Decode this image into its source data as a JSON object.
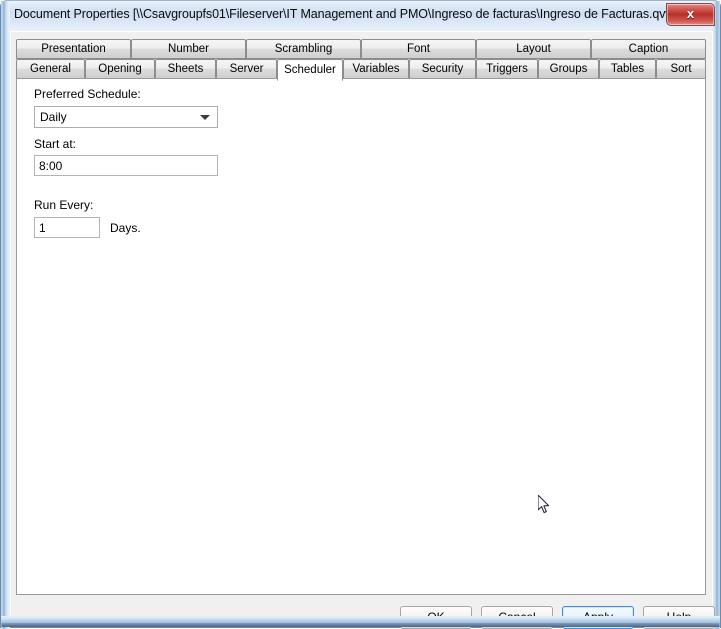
{
  "window": {
    "title": "Document Properties [\\\\Csavgroupfs01\\Fileserver\\IT Management and PMO\\Ingreso de facturas\\Ingreso de Facturas.qvw]",
    "close_glyph": "x",
    "close_label": "Close"
  },
  "tabs": {
    "top_row": [
      {
        "label": "Presentation",
        "active": false
      },
      {
        "label": "Number",
        "active": false
      },
      {
        "label": "Scrambling",
        "active": false
      },
      {
        "label": "Font",
        "active": false
      },
      {
        "label": "Layout",
        "active": false
      },
      {
        "label": "Caption",
        "active": false
      }
    ],
    "bottom_row": [
      {
        "label": "General",
        "active": false
      },
      {
        "label": "Opening",
        "active": false
      },
      {
        "label": "Sheets",
        "active": false
      },
      {
        "label": "Server",
        "active": false
      },
      {
        "label": "Scheduler",
        "active": true
      },
      {
        "label": "Variables",
        "active": false
      },
      {
        "label": "Security",
        "active": false
      },
      {
        "label": "Triggers",
        "active": false
      },
      {
        "label": "Groups",
        "active": false
      },
      {
        "label": "Tables",
        "active": false
      },
      {
        "label": "Sort",
        "active": false
      }
    ]
  },
  "scheduler": {
    "preferred_schedule_label": "Preferred Schedule:",
    "preferred_schedule_value": "Daily",
    "preferred_schedule_options": [
      "Daily"
    ],
    "start_at_label": "Start at:",
    "start_at_value": "8:00",
    "run_every_label": "Run Every:",
    "run_every_value": "1",
    "run_every_units": "Days."
  },
  "buttons": {
    "ok": "OK",
    "cancel": "Cancel",
    "apply": "Apply",
    "help": "Help"
  },
  "colors": {
    "accent": "#3c8ddc",
    "dialog_face": "#f0f0f0",
    "panel": "#ffffff",
    "close_red": "#c03a33"
  }
}
